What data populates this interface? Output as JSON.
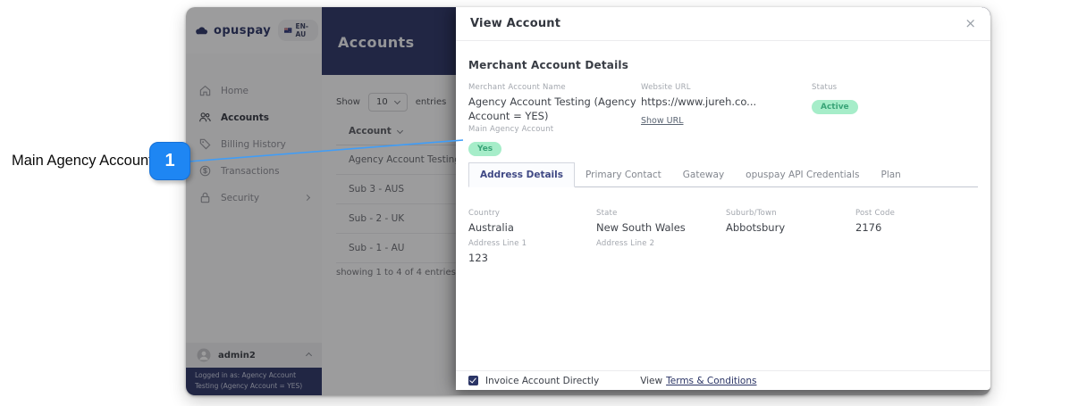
{
  "annotation": {
    "label": "Main Agency Account",
    "marker": "1",
    "accent_color": "#1e86f3"
  },
  "app": {
    "brand": {
      "name": "opuspay",
      "locale": "EN-AU"
    },
    "sidebar": {
      "items": [
        {
          "label": "Home",
          "icon": "home-icon",
          "active": false
        },
        {
          "label": "Accounts",
          "icon": "users-icon",
          "active": true
        },
        {
          "label": "Billing History",
          "icon": "tag-icon",
          "active": false
        },
        {
          "label": "Transactions",
          "icon": "dollar-circle-icon",
          "active": false
        },
        {
          "label": "Security",
          "icon": "lock-icon",
          "active": false,
          "has_submenu": true
        }
      ],
      "user": {
        "name": "admin2"
      },
      "footer_text": "Logged in as: Agency Account Testing (Agency Account = YES)"
    },
    "header": {
      "title": "Accounts"
    },
    "main": {
      "show_label": "Show",
      "page_size": "10",
      "entries_label": "entries",
      "table": {
        "column": "Account",
        "rows": [
          "Agency Account Testing (Agency Account = YES)",
          "Sub 3 - AUS",
          "Sub - 2 - UK",
          "Sub - 1 - AU"
        ]
      },
      "summary": "showing 1 to 4 of 4 entries"
    }
  },
  "modal": {
    "title": "View Account",
    "close_glyph": "×",
    "section_title": "Merchant Account Details",
    "fields": {
      "merchant_account_name": {
        "label": "Merchant Account Name",
        "value": "Agency Account Testing (Agency Account = YES)"
      },
      "website_url": {
        "label": "Website URL",
        "value": "https://www.jureh.co...",
        "link": "Show URL"
      },
      "status": {
        "label": "Status",
        "value": "Active",
        "color": "#a6edc9"
      },
      "main_agency_account": {
        "label": "Main Agency Account",
        "value": "Yes",
        "color": "#a6edc9"
      }
    },
    "tabs": [
      {
        "label": "Address Details",
        "active": true
      },
      {
        "label": "Primary Contact",
        "active": false
      },
      {
        "label": "Gateway",
        "active": false
      },
      {
        "label": "opuspay API Credentials",
        "active": false
      },
      {
        "label": "Plan",
        "active": false
      }
    ],
    "address": {
      "country": {
        "label": "Country",
        "value": "Australia"
      },
      "state": {
        "label": "State",
        "value": "New South Wales"
      },
      "suburb": {
        "label": "Suburb/Town",
        "value": "Abbotsbury"
      },
      "post_code": {
        "label": "Post Code",
        "value": "2176"
      },
      "address_line_1": {
        "label": "Address Line 1",
        "value": "123"
      },
      "address_line_2": {
        "label": "Address Line 2",
        "value": ""
      }
    },
    "footer": {
      "checkbox_label": "Invoice Account Directly",
      "checkbox_checked": true,
      "view_label": "View",
      "terms_link": "Terms & Conditions"
    }
  },
  "colors": {
    "navy": "#2b3566",
    "badge_green_bg": "#a6edc9",
    "badge_green_text": "#39a477",
    "annotation_blue": "#1e86f3"
  }
}
